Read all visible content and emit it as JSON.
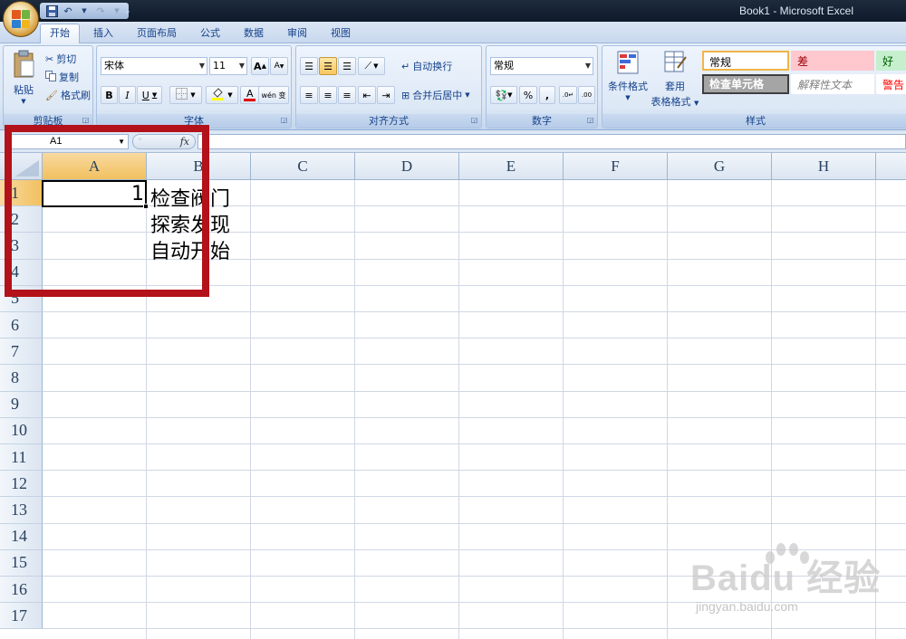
{
  "window_title": "Book1 - Microsoft Excel",
  "tabs": [
    "开始",
    "插入",
    "页面布局",
    "公式",
    "数据",
    "审阅",
    "视图"
  ],
  "active_tab": "开始",
  "ribbon": {
    "clipboard": {
      "paste": "粘贴",
      "cut": "剪切",
      "copy": "复制",
      "format_painter": "格式刷",
      "label": "剪贴板"
    },
    "font": {
      "font_name": "宋体",
      "font_size": "11",
      "bold": "B",
      "italic": "I",
      "underline": "U",
      "grow": "A",
      "shrink": "A",
      "font_color_letter": "A",
      "phonetic": "wén 变",
      "label": "字体"
    },
    "alignment": {
      "wrap_text": "自动换行",
      "merge_center": "合并后居中",
      "label": "对齐方式"
    },
    "number": {
      "format": "常规",
      "percent": "%",
      "comma": ",",
      "increase_decimal": "←.0 .00",
      "label": "数字"
    },
    "styles": {
      "conditional_formatting": "条件格式",
      "format_as_table_line1": "套用",
      "format_as_table_line2": "表格格式",
      "normal": "常规",
      "bad": "差",
      "good": "好",
      "check_cell": "检查单元格",
      "explanatory": "解释性文本",
      "warning": "警告",
      "label": "样式"
    }
  },
  "formula_bar": {
    "name_box": "A1",
    "fx": "fx",
    "formula": ""
  },
  "sheet": {
    "columns": [
      "A",
      "B",
      "C",
      "D",
      "E",
      "F",
      "G",
      "H"
    ],
    "rows": [
      "1",
      "2",
      "3",
      "4",
      "5",
      "6",
      "7",
      "8",
      "9",
      "10",
      "11",
      "12",
      "13",
      "14",
      "15",
      "16",
      "17"
    ],
    "cells": {
      "A1": "1",
      "B1": "检查阀门",
      "B2": "探索发现",
      "B3": "自动开始"
    },
    "active_cell": "A1"
  },
  "watermark": {
    "brand": "Baidu 经验",
    "url": "jingyan.baidu.com"
  },
  "colors": {
    "highlight_box": "#b3121a",
    "accent": "#f1c15f"
  }
}
